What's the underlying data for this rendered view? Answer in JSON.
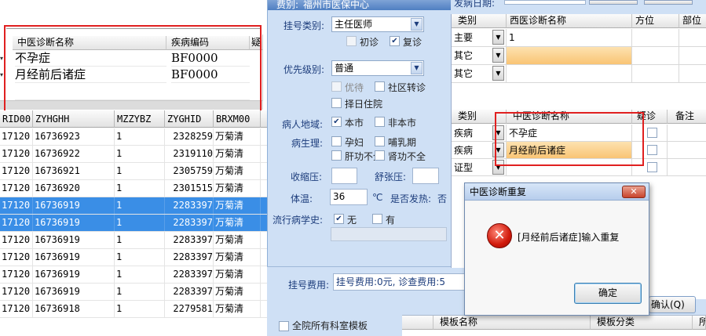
{
  "top_right_header": {
    "fee_label": "费别:",
    "fee_value": "福州市医保中心",
    "date_label": "发病日期:"
  },
  "diag_search": {
    "headers": [
      "中医诊断名称",
      "疾病编码",
      "疑"
    ],
    "rows": [
      {
        "name": "不孕症",
        "code": "BF0000"
      },
      {
        "name": "月经前后诸症",
        "code": "BF0000"
      }
    ]
  },
  "reg_list": {
    "headers": [
      "RID00",
      "ZYHGHH",
      "MZZYBZ",
      "ZYGHID",
      "BRXM00"
    ],
    "rows": [
      {
        "rid": "17120",
        "zyhghh": "16736923",
        "mzzybz": "1",
        "zyghid": "2328259",
        "name": "万菊清",
        "selected": false
      },
      {
        "rid": "17120",
        "zyhghh": "16736922",
        "mzzybz": "1",
        "zyghid": "2319110",
        "name": "万菊清",
        "selected": false
      },
      {
        "rid": "17120",
        "zyhghh": "16736921",
        "mzzybz": "1",
        "zyghid": "2305759",
        "name": "万菊清",
        "selected": false
      },
      {
        "rid": "17120",
        "zyhghh": "16736920",
        "mzzybz": "1",
        "zyghid": "2301515",
        "name": "万菊清",
        "selected": false
      },
      {
        "rid": "17120",
        "zyhghh": "16736919",
        "mzzybz": "1",
        "zyghid": "2283397",
        "name": "万菊清",
        "selected": true
      },
      {
        "rid": "17120",
        "zyhghh": "16736919",
        "mzzybz": "1",
        "zyghid": "2283397",
        "name": "万菊清",
        "selected": true
      },
      {
        "rid": "17120",
        "zyhghh": "16736919",
        "mzzybz": "1",
        "zyghid": "2283397",
        "name": "万菊清",
        "selected": false
      },
      {
        "rid": "17120",
        "zyhghh": "16736919",
        "mzzybz": "1",
        "zyghid": "2283397",
        "name": "万菊清",
        "selected": false
      },
      {
        "rid": "17120",
        "zyhghh": "16736919",
        "mzzybz": "1",
        "zyghid": "2283397",
        "name": "万菊清",
        "selected": false
      },
      {
        "rid": "17120",
        "zyhghh": "16736919",
        "mzzybz": "1",
        "zyghid": "2283397",
        "name": "万菊清",
        "selected": false
      },
      {
        "rid": "17120",
        "zyhghh": "16736918",
        "mzzybz": "1",
        "zyghid": "2279581",
        "name": "万菊清",
        "selected": false
      }
    ]
  },
  "form": {
    "reg_type_label": "挂号类别:",
    "reg_type_value": "主任医师",
    "first_visit": "初诊",
    "revisit": "复诊",
    "priority_label": "优先级别:",
    "priority_value": "普通",
    "priority_care": "优待",
    "community_transfer": "社区转诊",
    "select_day": "择日住院",
    "region_label": "病人地域:",
    "local": "本市",
    "nonlocal": "非本市",
    "physio_label": "病生理:",
    "pregnant": "孕妇",
    "lactation": "哺乳期",
    "liver": "肝功不全",
    "kidney": "肾功不全",
    "systolic_label": "收缩压:",
    "diastolic_label": "舒张压:",
    "temp_label": "体温:",
    "temp_value": "36",
    "temp_unit": "℃",
    "fever_label": "是否发热:",
    "fever_value": "否",
    "epi_label": "流行病学史:",
    "epi_none": "无",
    "epi_yes": "有",
    "fee_label": "挂号费用:",
    "fee_value": "挂号费用:0元, 诊查费用:5"
  },
  "western_diag": {
    "headers": [
      "类别",
      "西医诊断名称",
      "方位",
      "部位"
    ],
    "rows": [
      {
        "type": "主要",
        "name": "1"
      },
      {
        "type": "其它",
        "name": ""
      },
      {
        "type": "其它",
        "name": ""
      }
    ]
  },
  "tcm_diag": {
    "headers": [
      "类别",
      "中医诊断名称",
      "疑诊",
      "备注"
    ],
    "rows": [
      {
        "type": "疾病",
        "name": "不孕症"
      },
      {
        "type": "疾病",
        "name": "月经前后诸症"
      },
      {
        "type": "证型",
        "name": ""
      }
    ]
  },
  "bottom": {
    "all_templates": "全院所有科室模板",
    "confirm": "确认(Q)",
    "template_name": "模板名称",
    "template_type": "模板分类",
    "col_more": "所"
  },
  "dialog": {
    "title": "中医诊断重复",
    "message": "[月经前后诸症]输入重复",
    "ok": "确定",
    "close": "✕"
  },
  "colors": {
    "accent_red": "#e02020",
    "selection_blue": "#3a8ee6",
    "panel_blue": "#cfe0f5",
    "highlight_orange": "#f9c474"
  }
}
